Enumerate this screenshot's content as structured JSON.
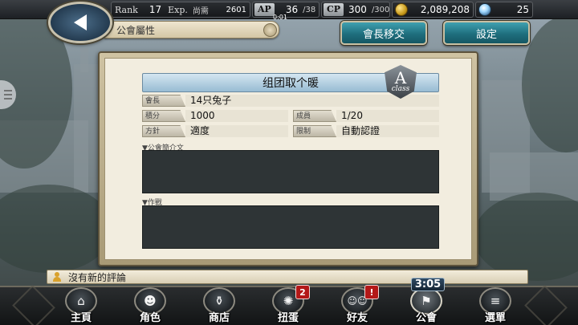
{
  "status_bar": {
    "rank_label": "Rank",
    "rank_value": "17",
    "exp_label": "Exp.",
    "exp_needed_label": "尚需",
    "exp_value": "2601",
    "ap_label": "AP",
    "ap_value": "36",
    "ap_max": "/38",
    "ap_timer": "0:01",
    "cp_label": "CP",
    "cp_value": "300",
    "cp_max": "/300",
    "gold_value": "2,089,208",
    "gem_value": "25"
  },
  "header": {
    "title": "公會屬性",
    "transfer_button": "會長移交",
    "settings_button": "設定"
  },
  "guild": {
    "name": "组团取个暖",
    "class_letter": "A",
    "class_word": "class",
    "leader_label": "會長",
    "leader_value": "14只兔子",
    "points_label": "積分",
    "points_value": "1000",
    "members_label": "成員",
    "members_value": "1/20",
    "policy_label": "方針",
    "policy_value": "適度",
    "limit_label": "限制",
    "limit_value": "自動認證",
    "intro_label": "▼公會簡介文",
    "strategy_label": "▼作戰"
  },
  "comment_bar": {
    "text": "沒有新的評論"
  },
  "clock": "3:05",
  "nav": [
    {
      "label": "主頁",
      "icon": "home-icon",
      "glyph": "⌂"
    },
    {
      "label": "角色",
      "icon": "character-icon",
      "glyph": "☻"
    },
    {
      "label": "商店",
      "icon": "shop-icon",
      "glyph": "⚱"
    },
    {
      "label": "扭蛋",
      "icon": "gacha-icon",
      "glyph": "✺",
      "badge": "2"
    },
    {
      "label": "好友",
      "icon": "friends-icon",
      "glyph": "☺☺",
      "badge": "!"
    },
    {
      "label": "公會",
      "icon": "guild-flag-icon",
      "glyph": "⚑"
    },
    {
      "label": "選單",
      "icon": "menu-icon",
      "glyph": "≡"
    }
  ],
  "colors": {
    "accent_teal": "#1f6f7e",
    "badge_red": "#b31818",
    "panel_bg": "#f2eddf",
    "text_box_bg": "#2e3436"
  }
}
